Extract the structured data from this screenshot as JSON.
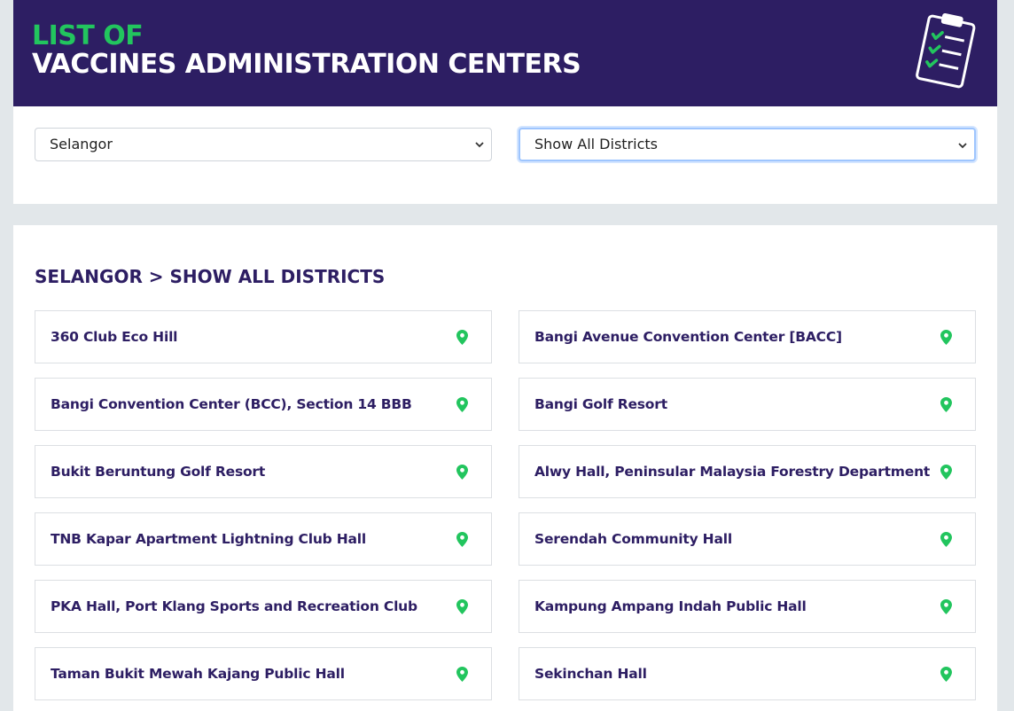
{
  "header": {
    "title_line1": "LIST OF",
    "title_line2": "VACCINES ADMINISTRATION CENTERS"
  },
  "filters": {
    "state": "Selangor",
    "district": "Show All Districts"
  },
  "results": {
    "title": "SELANGOR > SHOW ALL DISTRICTS",
    "centers": [
      "360 Club Eco Hill",
      "Bangi Avenue Convention Center [BACC]",
      "Bangi Convention Center (BCC), Section 14 BBB",
      "Bangi Golf Resort",
      "Bukit Beruntung Golf Resort",
      "Alwy Hall, Peninsular Malaysia Forestry Department",
      "TNB Kapar Apartment Lightning Club Hall",
      "Serendah Community Hall",
      "PKA Hall, Port Klang Sports and Recreation Club",
      "Kampung Ampang Indah Public Hall",
      "Taman Bukit Mewah Kajang Public Hall",
      "Sekinchan Hall"
    ]
  },
  "colors": {
    "header_bg": "#2d1e63",
    "accent_green": "#22c55e",
    "title_text": "#2d1e63"
  },
  "icons": {
    "header": "clipboard-checklist-icon",
    "location": "map-pin-icon",
    "dropdown": "chevron-down-icon"
  }
}
